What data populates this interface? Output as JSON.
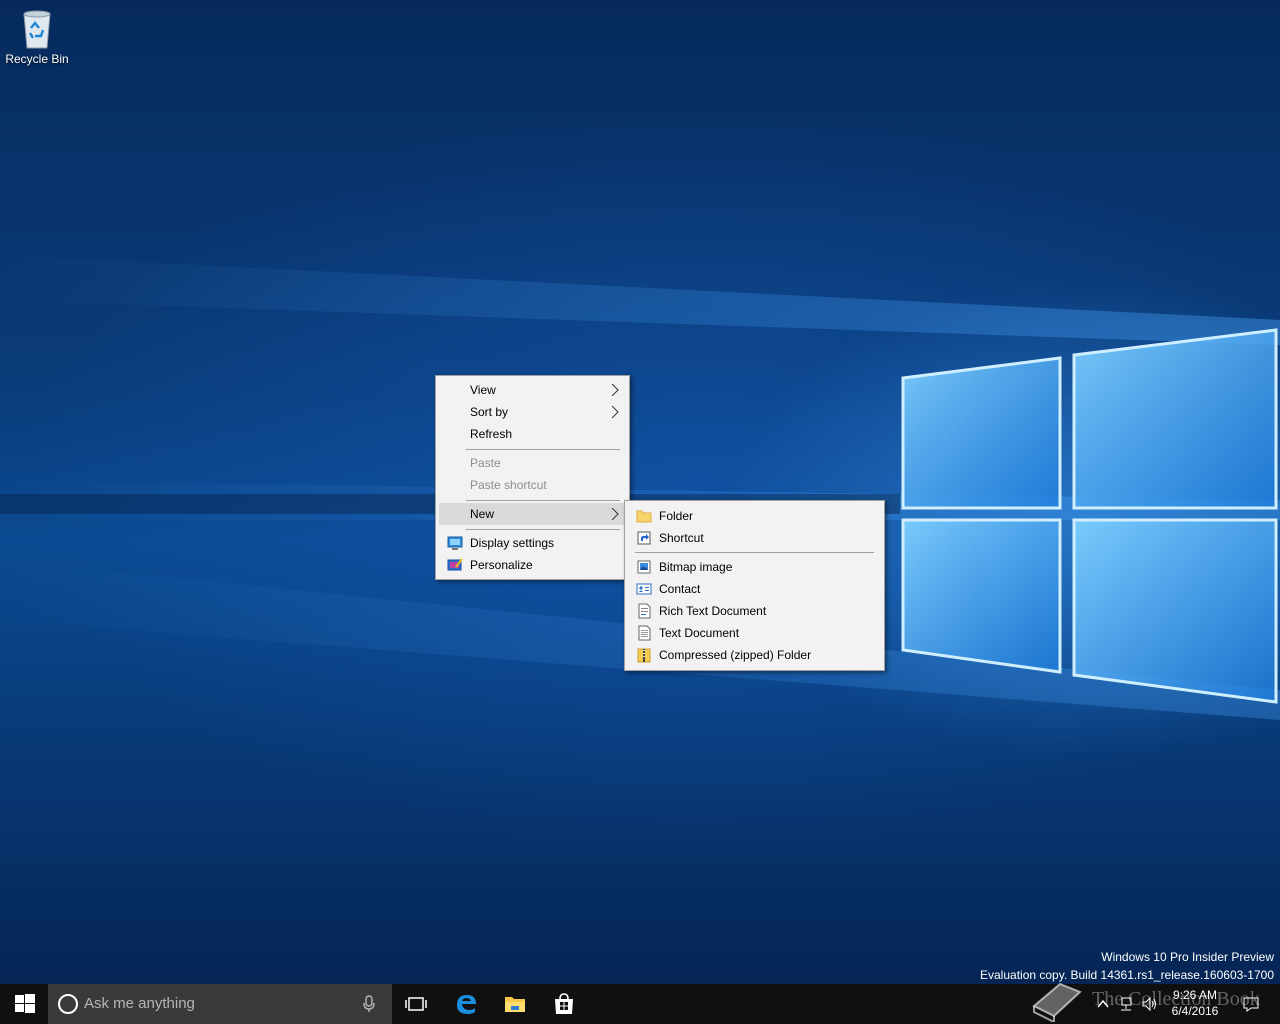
{
  "desktop": {
    "icons": [
      {
        "label": "Recycle Bin",
        "icon": "recycle-bin-icon"
      }
    ],
    "watermark": {
      "line1": "Windows 10 Pro Insider Preview",
      "line2": "Evaluation copy. Build 14361.rs1_release.160603-1700"
    }
  },
  "context_menu": {
    "items": [
      {
        "label": "View",
        "submenu": true
      },
      {
        "label": "Sort by",
        "submenu": true
      },
      {
        "label": "Refresh"
      },
      {
        "label": "Paste",
        "disabled": true
      },
      {
        "label": "Paste shortcut",
        "disabled": true
      },
      {
        "label": "New",
        "submenu": true,
        "active": true
      },
      {
        "label": "Display settings",
        "icon": "display-icon"
      },
      {
        "label": "Personalize",
        "icon": "personalize-icon"
      }
    ]
  },
  "new_submenu": {
    "items": [
      {
        "label": "Folder",
        "icon": "folder-icon"
      },
      {
        "label": "Shortcut",
        "icon": "shortcut-icon"
      },
      {
        "label": "Bitmap image",
        "icon": "bitmap-icon"
      },
      {
        "label": "Contact",
        "icon": "contact-icon"
      },
      {
        "label": "Rich Text Document",
        "icon": "rich-text-icon"
      },
      {
        "label": "Text Document",
        "icon": "text-document-icon"
      },
      {
        "label": "Compressed (zipped) Folder",
        "icon": "zip-folder-icon"
      }
    ]
  },
  "taskbar": {
    "search_placeholder": "Ask me anything",
    "pinned": [
      "task-view-icon",
      "edge-icon",
      "file-explorer-icon",
      "store-icon"
    ],
    "clock": {
      "time": "9:26 AM",
      "date": "6/4/2016"
    }
  },
  "overlay": {
    "logo_text": "The Collection Book"
  },
  "colors": {
    "accent": "#0078d7",
    "menu_bg": "#f2f2f2",
    "menu_active": "#d9d9d9",
    "taskbar": "#101010"
  }
}
